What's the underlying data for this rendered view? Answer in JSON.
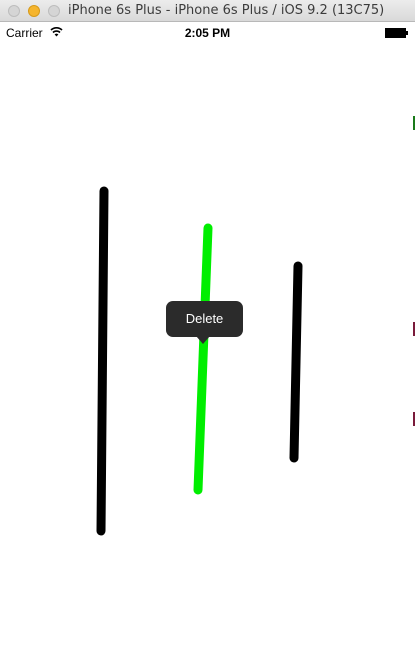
{
  "window": {
    "title": "iPhone 6s Plus - iPhone 6s Plus / iOS 9.2 (13C75)"
  },
  "status_bar": {
    "carrier": "Carrier",
    "time": "2:05 PM"
  },
  "context_menu": {
    "delete_label": "Delete"
  },
  "colors": {
    "stroke_default": "#000000",
    "stroke_selected": "#00ee00",
    "menu_background": "#2b2b2b"
  }
}
